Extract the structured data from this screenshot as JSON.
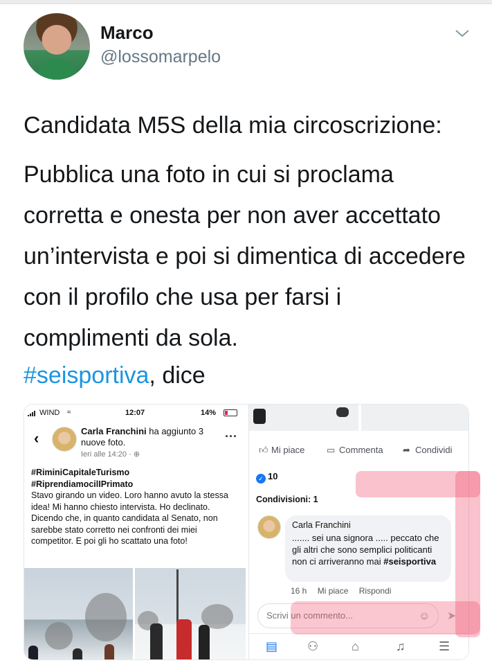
{
  "tweet": {
    "author_name": "Marco",
    "author_handle": "@lossomarpelo",
    "lines": [
      "Candidata M5S della mia circoscrizione:",
      "Pubblica una foto in cui si proclama corretta e onesta per non aver accettato un’intervista e poi si dimentica di accedere con il profilo che usa per farsi i complimenti da sola."
    ],
    "hashtag": "#seisportiva",
    "hashtag_suffix": ", dice"
  },
  "screenshot": {
    "status": {
      "carrier": "WIND",
      "time": "12:07",
      "battery": "14%"
    },
    "post": {
      "author": "Carla Franchini",
      "action": " ha aggiunto 3 nuove foto.",
      "time": "Ieri alle 14:20 · ",
      "tag1": "#RiminiCapitaleTurismo",
      "tag2": "#RiprendiamocilIPrimato",
      "body": "Stavo girando un video. Loro  hanno avuto la stessa idea! Mi hanno chiesto intervista. Ho declinato. Dicendo che,  in quanto candidata al Senato, non sarebbe stato corretto  nei confronti dei miei competitor. E poi gli ho scattato una foto!"
    },
    "actions": {
      "like": "Mi piace",
      "comment": "Commenta",
      "share": "Condividi"
    },
    "likes_count": "10",
    "shares_label": "Condivisioni: 1",
    "comment": {
      "author": "Carla Franchini",
      "body": "....... sei una signora ..... peccato che gli altri che sono semplici politicanti non ci arriveranno mai ",
      "tag": "#seisportiva",
      "time": "16 h",
      "like": "Mi piace",
      "reply": "Rispondi"
    },
    "comment_placeholder": "Scrivi un commento...",
    "highlight_color": "#f0506e"
  }
}
